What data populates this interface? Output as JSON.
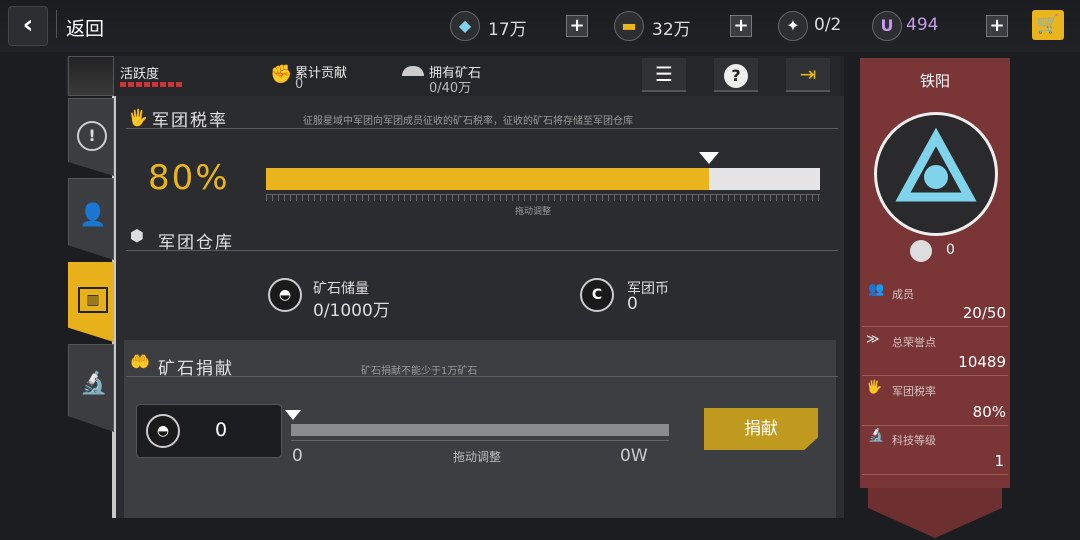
{
  "topbar": {
    "back_label": "返回",
    "crystal": {
      "icon": "crystal-icon",
      "value": "17万"
    },
    "gold": {
      "icon": "gold-icon",
      "value": "32万"
    },
    "energy": {
      "icon": "energy-icon",
      "value": "0/2"
    },
    "u_currency": {
      "icon": "u-icon",
      "symbol": "U",
      "value": "494"
    }
  },
  "subheader": {
    "activity_label": "活跃度",
    "contribution_label": "累计贡献",
    "contribution_value": "0",
    "ore_owned_label": "拥有矿石",
    "ore_owned_value": "0/40万"
  },
  "tax": {
    "title": "军团税率",
    "description": "征服星域中军团向军团成员征收的矿石税率，征收的矿石将存储至军团仓库",
    "value_text": "80%",
    "fill_fraction": 0.8,
    "drag_hint": "拖动调整"
  },
  "warehouse": {
    "title": "军团仓库",
    "ore_label": "矿石储量",
    "ore_value": "0/1000万",
    "coin_label": "军团币",
    "coin_value": "0"
  },
  "donate": {
    "title": "矿石捐献",
    "hint": "矿石捐献不能少于1万矿石",
    "amount": "0",
    "min_label": "0",
    "drag_hint": "拖动调整",
    "max_label": "0W",
    "button_label": "捐献"
  },
  "legion": {
    "name": "铁阳",
    "badge_value": "0",
    "members_label": "成员",
    "members_value": "20/50",
    "honor_label": "总荣誉点",
    "honor_value": "10489",
    "tax_label": "军团税率",
    "tax_value": "80%",
    "tech_label": "科技等级",
    "tech_value": "1"
  },
  "colors": {
    "accent": "#eab41d",
    "panel_red": "#7a3637",
    "logo_cyan": "#7fd3ea"
  }
}
